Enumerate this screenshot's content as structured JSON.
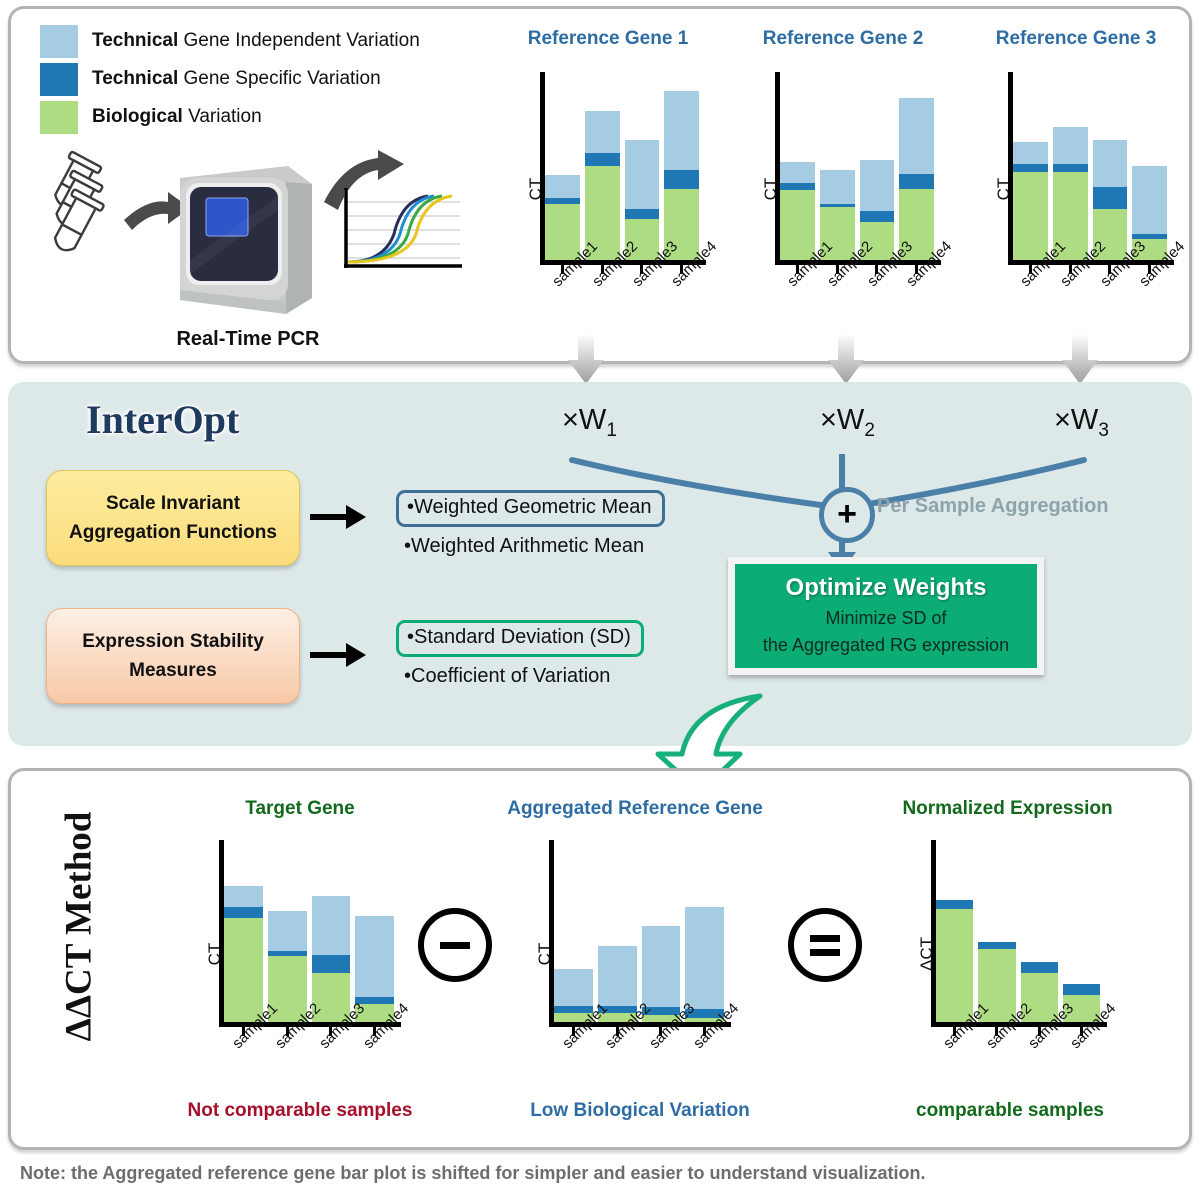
{
  "legend": {
    "items": [
      {
        "bold": "Technical",
        "rest": " Gene Independent Variation",
        "color": "#a6cce3",
        "icon": "legend-swatch-technical-independent"
      },
      {
        "bold": "Technical",
        "rest": " Gene Specific Variation",
        "color": "#1f78b4",
        "icon": "legend-swatch-technical-specific"
      },
      {
        "bold": "Biological",
        "rest": " Variation",
        "color": "#aedc82",
        "icon": "legend-swatch-biological"
      }
    ]
  },
  "pcr": {
    "caption": "Real-Time PCR"
  },
  "colors": {
    "technical_independent": "#a6cce3",
    "technical_specific": "#1f78b4",
    "biological": "#aedc82",
    "panel_background": "#dde8e8",
    "accent_blue": "#2e6da4",
    "accent_green": "#0cac75",
    "title_blue": "#2e6da4",
    "title_green": "#12691c",
    "caption_red": "#a5112a",
    "gray_text": "#8fa3ab"
  },
  "top": {
    "weights": [
      "×W",
      "×W",
      "×W"
    ],
    "weight_subs": [
      "1",
      "2",
      "3"
    ]
  },
  "interopt": {
    "title": "InterOpt",
    "box_aggregation_line1": "Scale Invariant",
    "box_aggregation_line2": "Aggregation Functions",
    "box_stability_line1": "Expression Stability",
    "box_stability_line2": "Measures",
    "aggregation_options": [
      "•Weighted Geometric Mean",
      "•Weighted Arithmetic Mean"
    ],
    "stability_options": [
      "•Standard Deviation (SD)",
      "•Coefficient of Variation"
    ],
    "per_sample_aggregation": "Per Sample Aggregation",
    "plus_symbol": "+",
    "optimize_title": "Optimize Weights",
    "optimize_line1": "Minimize SD of",
    "optimize_line2": "the Aggregated RG expression"
  },
  "bottom": {
    "method_label": "ΔΔCT Method",
    "minus_symbol": "minus-circle-icon",
    "equals_symbol": "equals-circle-icon",
    "captions": {
      "target": "Not comparable samples",
      "aggregated": "Low Biological Variation",
      "normalized": "comparable samples"
    }
  },
  "note": "Note: the Aggregated reference gene bar plot is shifted for simpler and easier to understand visualization.",
  "chart_data": [
    {
      "id": "reference-gene-1",
      "type": "bar",
      "title": "Reference Gene 1",
      "title_color": "#2e6da4",
      "ylabel": "CT",
      "categories": [
        "sample1",
        "sample2",
        "sample3",
        "sample4"
      ],
      "ylim": [
        0,
        100
      ],
      "grid": false,
      "legend": "none",
      "series": [
        {
          "name": "Biological Variation",
          "color": "#aedc82",
          "values": [
            30,
            50,
            22,
            38
          ]
        },
        {
          "name": "Technical Gene Specific Variation",
          "color": "#1f78b4",
          "values": [
            3,
            7,
            5,
            10
          ]
        },
        {
          "name": "Technical Gene Independent Variation",
          "color": "#a6cce3",
          "values": [
            12,
            22,
            37,
            42
          ]
        }
      ]
    },
    {
      "id": "reference-gene-2",
      "type": "bar",
      "title": "Reference Gene 2",
      "title_color": "#2e6da4",
      "ylabel": "CT",
      "categories": [
        "sample1",
        "sample2",
        "sample3",
        "sample4"
      ],
      "ylim": [
        0,
        100
      ],
      "grid": false,
      "legend": "none",
      "series": [
        {
          "name": "Biological Variation",
          "color": "#aedc82",
          "values": [
            37,
            28,
            20,
            38
          ]
        },
        {
          "name": "Technical Gene Specific Variation",
          "color": "#1f78b4",
          "values": [
            4,
            2,
            6,
            8
          ]
        },
        {
          "name": "Technical Gene Independent Variation",
          "color": "#a6cce3",
          "values": [
            11,
            18,
            27,
            40
          ]
        }
      ]
    },
    {
      "id": "reference-gene-3",
      "type": "bar",
      "title": "Reference Gene 3",
      "title_color": "#2e6da4",
      "ylabel": "CT",
      "categories": [
        "sample1",
        "sample2",
        "sample3",
        "sample4"
      ],
      "ylim": [
        0,
        100
      ],
      "grid": false,
      "legend": "none",
      "series": [
        {
          "name": "Biological Variation",
          "color": "#aedc82",
          "values": [
            47,
            47,
            27,
            11
          ]
        },
        {
          "name": "Technical Gene Specific Variation",
          "color": "#1f78b4",
          "values": [
            4,
            4,
            12,
            3
          ]
        },
        {
          "name": "Technical Gene Independent Variation",
          "color": "#a6cce3",
          "values": [
            12,
            20,
            25,
            36
          ]
        }
      ]
    },
    {
      "id": "target-gene",
      "type": "bar",
      "title": "Target Gene",
      "title_color": "#12691c",
      "ylabel": "CT",
      "categories": [
        "sample1",
        "sample2",
        "sample3",
        "sample4"
      ],
      "ylim": [
        0,
        100
      ],
      "grid": false,
      "legend": "none",
      "series": [
        {
          "name": "Biological Variation",
          "color": "#aedc82",
          "values": [
            57,
            36,
            27,
            10
          ]
        },
        {
          "name": "Technical Gene Specific Variation",
          "color": "#1f78b4",
          "values": [
            6,
            3,
            10,
            4
          ]
        },
        {
          "name": "Technical Gene Independent Variation",
          "color": "#a6cce3",
          "values": [
            12,
            22,
            32,
            44
          ]
        }
      ]
    },
    {
      "id": "aggregated-reference-gene",
      "type": "bar",
      "title": "Aggregated Reference Gene",
      "title_color": "#2e6da4",
      "ylabel": "CT",
      "categories": [
        "sample1",
        "sample2",
        "sample3",
        "sample4"
      ],
      "ylim": [
        0,
        100
      ],
      "grid": false,
      "legend": "none",
      "series": [
        {
          "name": "Biological Variation",
          "color": "#aedc82",
          "values": [
            5,
            5,
            4,
            2
          ]
        },
        {
          "name": "Technical Gene Specific Variation",
          "color": "#1f78b4",
          "values": [
            4,
            4,
            4,
            5
          ]
        },
        {
          "name": "Technical Gene Independent Variation",
          "color": "#a6cce3",
          "values": [
            20,
            33,
            45,
            56
          ]
        }
      ]
    },
    {
      "id": "normalized-expression",
      "type": "bar",
      "title": "Normalized Expression",
      "title_color": "#12691c",
      "ylabel": "ΔCT",
      "categories": [
        "sample1",
        "sample2",
        "sample3",
        "sample4"
      ],
      "ylim": [
        0,
        100
      ],
      "grid": false,
      "legend": "none",
      "series": [
        {
          "name": "Biological Variation",
          "color": "#aedc82",
          "values": [
            62,
            40,
            27,
            15
          ]
        },
        {
          "name": "Technical Gene Specific Variation",
          "color": "#1f78b4",
          "values": [
            5,
            4,
            6,
            6
          ]
        },
        {
          "name": "Technical Gene Independent Variation",
          "color": "#a6cce3",
          "values": [
            0,
            0,
            0,
            0
          ]
        }
      ]
    }
  ]
}
